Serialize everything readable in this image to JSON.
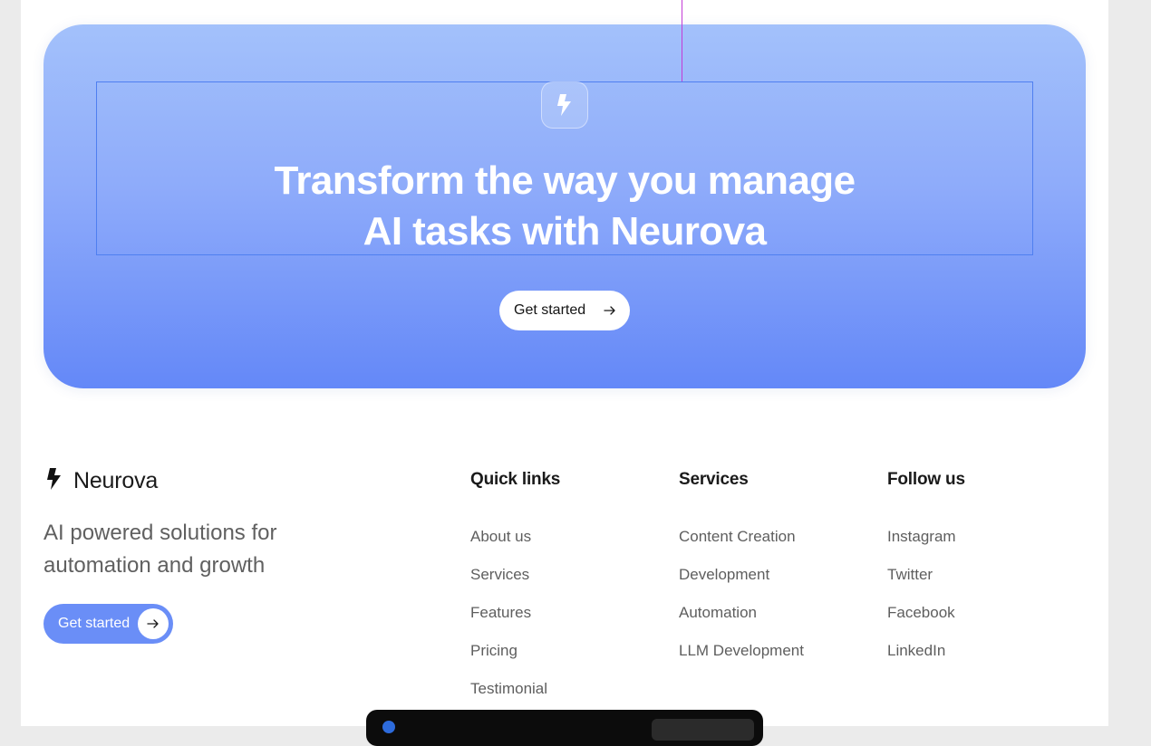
{
  "hero": {
    "icon": "bolt-icon",
    "title_line1": "Transform the way you manage",
    "title_line2_bold": "AI",
    "title_line2_rest": " tasks with Neurova",
    "button_label": "Get started",
    "button_icon": "arrow-right-icon"
  },
  "footer": {
    "brand": {
      "icon": "bolt-icon",
      "name": "Neurova"
    },
    "tagline": "AI powered solutions for automation and growth",
    "button_label": "Get started",
    "columns": [
      {
        "title": "Quick links",
        "links": [
          "About us",
          "Services",
          "Features",
          "Pricing",
          "Testimonial"
        ]
      },
      {
        "title": "Services",
        "links": [
          "Content Creation",
          "Development",
          "Automation",
          "LLM Development"
        ]
      },
      {
        "title": "Follow us",
        "links": [
          "Instagram",
          "Twitter",
          "Facebook",
          "LinkedIn"
        ]
      }
    ]
  },
  "colors": {
    "gradient_top": "#a3c1fb",
    "gradient_bottom": "#6488f8",
    "accent_button": "#6a8ef7",
    "selection_outline": "#4f7ff0",
    "guide_line": "#c33bd6"
  }
}
